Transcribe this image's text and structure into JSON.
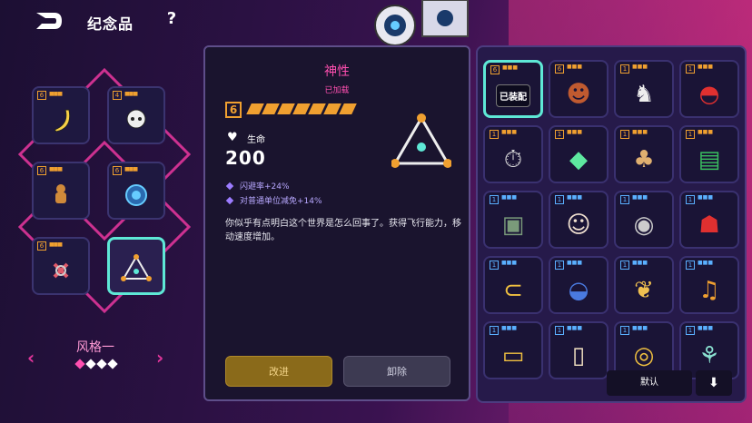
{
  "header": {
    "title": "纪念品",
    "help": "?"
  },
  "left": {
    "slots": [
      {
        "tier": "6",
        "icon": "banana-icon",
        "color": "#f0a030"
      },
      {
        "tier": "4",
        "icon": "skull-icon",
        "color": "#f0a030"
      },
      {
        "tier": "6",
        "icon": "gingerbread-icon",
        "color": "#f0a030"
      },
      {
        "tier": "6",
        "icon": "shield-orb-icon",
        "color": "#f0a030"
      },
      {
        "tier": "6",
        "icon": "chain-icon",
        "color": "#f0a030"
      },
      {
        "tier": "",
        "icon": "triangle-artifact-icon",
        "color": "#5ee8d6"
      }
    ],
    "style_label": "风格一",
    "left_arrow": "‹",
    "right_arrow": "›"
  },
  "detail": {
    "name": "神性",
    "status": "已加载",
    "cost": "6",
    "cost_pips": 7,
    "hp_label": "生命",
    "hp_value": "200",
    "stats": [
      "闪避率+24%",
      "对普通单位减免+14%"
    ],
    "description": "你似乎有点明白这个世界是怎么回事了。获得飞行能力，移动速度增加。",
    "upgrade": "改进",
    "remove": "卸除"
  },
  "inventory": {
    "equipped_label": "已装配",
    "items": [
      {
        "tier": "6",
        "blue": false,
        "icon": "equipped-triangle-icon",
        "equipped": true
      },
      {
        "tier": "6",
        "blue": false,
        "icon": "monster-head-icon"
      },
      {
        "tier": "1",
        "blue": false,
        "icon": "horse-head-icon"
      },
      {
        "tier": "1",
        "blue": false,
        "icon": "cap-icon"
      },
      {
        "tier": "1",
        "blue": false,
        "icon": "stopwatch-icon"
      },
      {
        "tier": "1",
        "blue": false,
        "icon": "crystal-icon"
      },
      {
        "tier": "1",
        "blue": false,
        "icon": "mushroom-icon"
      },
      {
        "tier": "1",
        "blue": false,
        "icon": "cash-icon"
      },
      {
        "tier": "1",
        "blue": true,
        "icon": "frame-icon"
      },
      {
        "tier": "1",
        "blue": true,
        "icon": "lucky-cat-icon"
      },
      {
        "tier": "1",
        "blue": true,
        "icon": "eye-icon"
      },
      {
        "tier": "1",
        "blue": true,
        "icon": "mask-icon"
      },
      {
        "tier": "1",
        "blue": true,
        "icon": "headband-icon"
      },
      {
        "tier": "1",
        "blue": true,
        "icon": "helmet-icon"
      },
      {
        "tier": "1",
        "blue": true,
        "icon": "leaf-icon"
      },
      {
        "tier": "1",
        "blue": true,
        "icon": "bell-icon"
      },
      {
        "tier": "1",
        "blue": true,
        "icon": "badge-icon"
      },
      {
        "tier": "1",
        "blue": true,
        "icon": "card-icon"
      },
      {
        "tier": "1",
        "blue": true,
        "icon": "ring-icon"
      },
      {
        "tier": "1",
        "blue": true,
        "icon": "sprout-icon"
      }
    ],
    "default_btn": "默认",
    "sort_btn": "⬇"
  }
}
